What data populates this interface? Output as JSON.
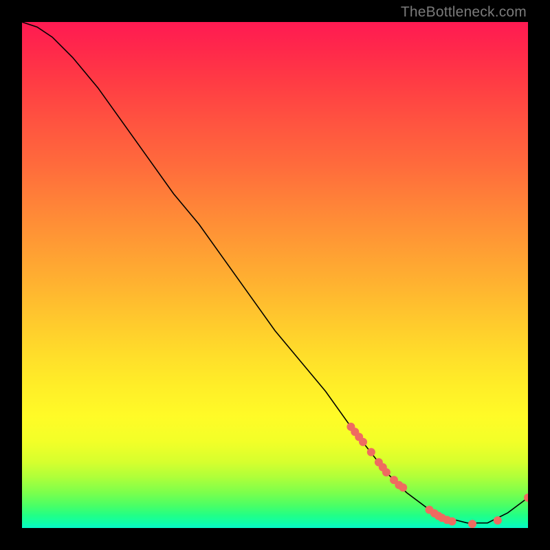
{
  "watermark": "TheBottleneck.com",
  "chart_data": {
    "type": "line",
    "title": "",
    "xlabel": "",
    "ylabel": "",
    "xlim": [
      0,
      100
    ],
    "ylim": [
      0,
      100
    ],
    "grid": false,
    "legend": false,
    "series": [
      {
        "name": "bottleneck-curve",
        "color": "#000000",
        "x": [
          0,
          3,
          6,
          10,
          15,
          20,
          25,
          30,
          35,
          40,
          45,
          50,
          55,
          60,
          65,
          72,
          76,
          80,
          84,
          88,
          92,
          96,
          100
        ],
        "values": [
          100,
          99,
          97,
          93,
          87,
          80,
          73,
          66,
          60,
          53,
          46,
          39,
          33,
          27,
          20,
          11,
          7,
          4,
          2,
          1,
          1,
          3,
          6
        ]
      }
    ],
    "markers": [
      {
        "name": "lower-segment-markers",
        "color": "#ef6b60",
        "radius": 6,
        "points": [
          {
            "x": 65.0,
            "y": 20.0
          },
          {
            "x": 65.8,
            "y": 19.0
          },
          {
            "x": 66.6,
            "y": 18.0
          },
          {
            "x": 67.4,
            "y": 17.0
          },
          {
            "x": 69.0,
            "y": 15.0
          },
          {
            "x": 70.5,
            "y": 13.0
          },
          {
            "x": 71.3,
            "y": 12.0
          },
          {
            "x": 72.0,
            "y": 11.0
          },
          {
            "x": 73.5,
            "y": 9.5
          },
          {
            "x": 74.5,
            "y": 8.5
          },
          {
            "x": 75.3,
            "y": 8.0
          },
          {
            "x": 80.5,
            "y": 3.6
          },
          {
            "x": 81.5,
            "y": 2.9
          },
          {
            "x": 82.3,
            "y": 2.4
          },
          {
            "x": 83.0,
            "y": 2.0
          },
          {
            "x": 84.0,
            "y": 1.6
          },
          {
            "x": 85.0,
            "y": 1.3
          },
          {
            "x": 89.0,
            "y": 0.8
          },
          {
            "x": 94.0,
            "y": 1.5
          },
          {
            "x": 100.0,
            "y": 6.0
          }
        ]
      }
    ]
  }
}
